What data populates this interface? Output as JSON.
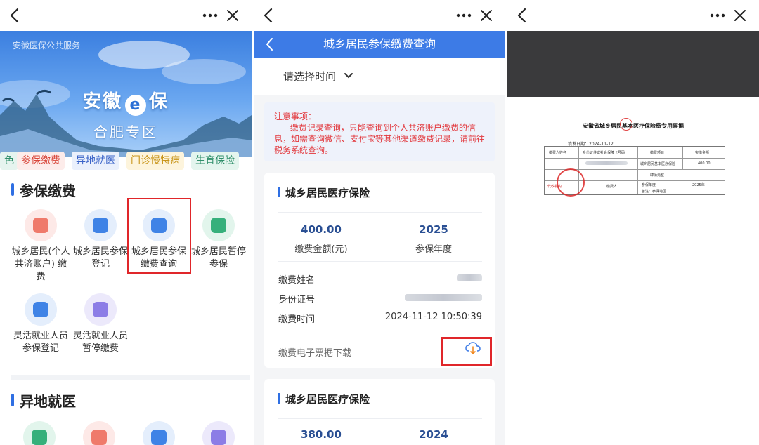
{
  "panel1": {
    "banner": {
      "subtitle": "安徽医保公共服务",
      "title_left": "安徽",
      "title_logo": "e",
      "title_right": "保",
      "region": "合肥专区"
    },
    "tags": [
      {
        "label": "色",
        "color": "#2f8f6a",
        "bg": "#e6f4ef"
      },
      {
        "label": "参保缴费",
        "color": "#d8463a",
        "bg": "#fdecea"
      },
      {
        "label": "异地就医",
        "color": "#3a63c8",
        "bg": "#eaf0fc"
      },
      {
        "label": "门诊慢特病",
        "color": "#c89418",
        "bg": "#fdf4dc"
      },
      {
        "label": "生育保险",
        "color": "#2f8f6a",
        "bg": "#e4f5ee"
      }
    ],
    "section1_title": "参保缴费",
    "services": [
      {
        "label": "城乡居民(个人共济账户) 缴费",
        "icon": "id-card-icon",
        "ring": "#fde9e7",
        "core": "#ef7a6b"
      },
      {
        "label": "城乡居民参保登记",
        "icon": "person-shield-icon",
        "ring": "#e4eefc",
        "core": "#3f83e6"
      },
      {
        "label": "城乡居民参保缴费查询",
        "icon": "person-shield-icon",
        "ring": "#e4eefc",
        "core": "#3f83e6"
      },
      {
        "label": "城乡居民暂停参保",
        "icon": "pause-icon",
        "ring": "#e2f5ec",
        "core": "#36b07b"
      },
      {
        "label": "灵活就业人员参保登记",
        "icon": "briefcase-icon",
        "ring": "#e4eefc",
        "core": "#3f83e6"
      },
      {
        "label": "灵活就业人员暂停缴费",
        "icon": "yen-shield-icon",
        "ring": "#ece9fb",
        "core": "#8c7de6"
      }
    ],
    "section2_title": "异地就医"
  },
  "panel2": {
    "header_title": "城乡居民参保缴费查询",
    "time_selector": "请选择时间",
    "notice": "注意事项：\n      缴费记录查询，只能查询到个人共济账户缴费的信息，如需查询微信、支付宝等其他渠道缴费记录，请前往税务系统查询。",
    "card1": {
      "title": "城乡居民医疗保险",
      "amount": "400.00",
      "amount_label": "缴费金额(元)",
      "year": "2025",
      "year_label": "参保年度",
      "name_label": "缴费姓名",
      "id_label": "身份证号",
      "time_label": "缴费时间",
      "time_value": "2024-11-12 10:50:39",
      "download_label": "缴费电子票据下载"
    },
    "card2": {
      "title": "城乡居民医疗保险",
      "amount": "380.00",
      "year": "2024"
    }
  },
  "panel3": {
    "receipt_title": "安徽省城乡居民基本医疗保险费专用票据",
    "date": "填发日期：2024-11-12",
    "headers": [
      "缴费人姓名",
      "身份证件或社会保障卡号码",
      "缴费项目",
      "实缴金额"
    ],
    "item": "城乡居民基本医疗保险",
    "amount": "400.00",
    "capital_label": "肆佰元整",
    "collector_label": "缴费人",
    "year_label": "参保年度",
    "year_value": "2025年",
    "remark": "备注：参保地区",
    "stamp_label": "代收机构"
  }
}
